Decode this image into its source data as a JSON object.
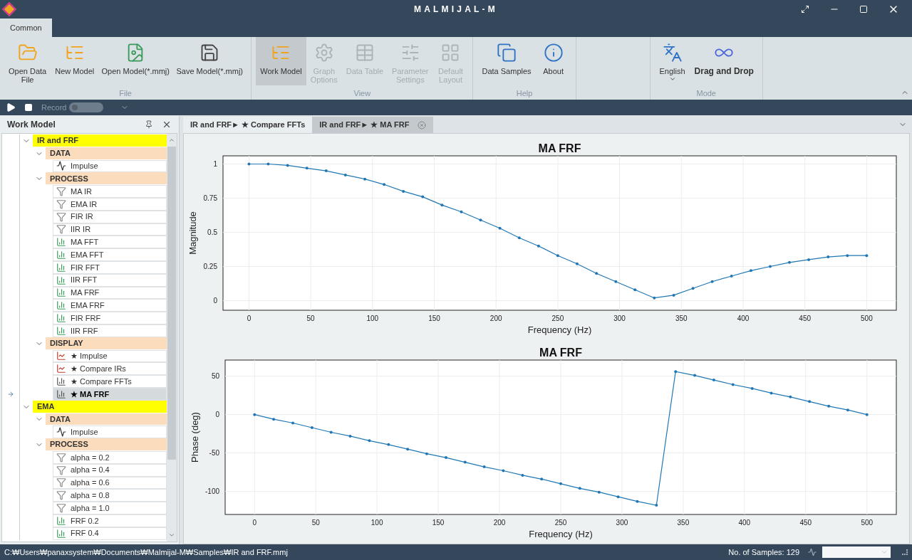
{
  "window": {
    "title": "MALMIJAL-M"
  },
  "ribbon_tabs": [
    {
      "label": "Common",
      "selected": true
    }
  ],
  "ribbon_groups": [
    {
      "label": "File",
      "buttons": [
        {
          "label": "Open Data\nFile",
          "selected": false,
          "disabled": false
        },
        {
          "label": "New Model",
          "selected": false,
          "disabled": false
        },
        {
          "label": "Open Model(*.mmj)",
          "selected": false,
          "disabled": false
        },
        {
          "label": "Save Model(*.mmj)",
          "selected": false,
          "disabled": false
        }
      ]
    },
    {
      "label": "View",
      "buttons": [
        {
          "label": "Work Model",
          "selected": true,
          "disabled": false
        },
        {
          "label": "Graph\nOptions",
          "selected": false,
          "disabled": true
        },
        {
          "label": "Data Table",
          "selected": false,
          "disabled": true
        },
        {
          "label": "Parameter\nSettings",
          "selected": false,
          "disabled": true
        },
        {
          "label": "Default\nLayout",
          "selected": false,
          "disabled": true
        }
      ]
    },
    {
      "label": "Help",
      "buttons": [
        {
          "label": "Data Samples",
          "selected": false,
          "disabled": false
        },
        {
          "label": "About",
          "selected": false,
          "disabled": false
        }
      ]
    },
    {
      "label": "Mode",
      "buttons": [
        {
          "label": "English",
          "selected": false,
          "disabled": false
        },
        {
          "label": "Drag and Drop",
          "selected": false,
          "disabled": false
        }
      ]
    }
  ],
  "toolbar": {
    "record_label": "Record",
    "record_on": false
  },
  "work_model": {
    "title": "Work Model",
    "tree": [
      {
        "label": "IR and FRF",
        "expanded": true,
        "children": [
          {
            "label": "DATA",
            "expanded": true,
            "children": [
              {
                "label": "Impulse",
                "kind": "signal",
                "selected": false
              }
            ]
          },
          {
            "label": "PROCESS",
            "expanded": true,
            "children": [
              {
                "label": "MA IR",
                "kind": "filter",
                "selected": false
              },
              {
                "label": "EMA IR",
                "kind": "filter",
                "selected": false
              },
              {
                "label": "FIR IR",
                "kind": "filter",
                "selected": false
              },
              {
                "label": "IIR IR",
                "kind": "filter",
                "selected": false
              },
              {
                "label": "MA FFT",
                "kind": "spectrum",
                "selected": false
              },
              {
                "label": "EMA FFT",
                "kind": "spectrum",
                "selected": false
              },
              {
                "label": "FIR FFT",
                "kind": "spectrum",
                "selected": false
              },
              {
                "label": "IIR FFT",
                "kind": "spectrum",
                "selected": false
              },
              {
                "label": "MA FRF",
                "kind": "spectrum",
                "selected": false
              },
              {
                "label": "EMA FRF",
                "kind": "spectrum",
                "selected": false
              },
              {
                "label": "FIR FRF",
                "kind": "spectrum",
                "selected": false
              },
              {
                "label": "IIR FRF",
                "kind": "spectrum",
                "selected": false
              }
            ]
          },
          {
            "label": "DISPLAY",
            "expanded": true,
            "children": [
              {
                "label": "★ Impulse",
                "kind": "line-plot",
                "selected": false
              },
              {
                "label": "★ Compare IRs",
                "kind": "line-plot",
                "selected": false
              },
              {
                "label": "★ Compare FFTs",
                "kind": "bar-plot",
                "selected": false
              },
              {
                "label": "★ MA FRF",
                "kind": "bar-plot",
                "selected": true
              }
            ]
          }
        ]
      },
      {
        "label": "EMA",
        "expanded": true,
        "children": [
          {
            "label": "DATA",
            "expanded": true,
            "children": [
              {
                "label": "Impulse",
                "kind": "signal",
                "selected": false
              }
            ]
          },
          {
            "label": "PROCESS",
            "expanded": true,
            "children": [
              {
                "label": "alpha = 0.2",
                "kind": "filter",
                "selected": false
              },
              {
                "label": "alpha = 0.4",
                "kind": "filter",
                "selected": false
              },
              {
                "label": "alpha = 0.6",
                "kind": "filter",
                "selected": false
              },
              {
                "label": "alpha = 0.8",
                "kind": "filter",
                "selected": false
              },
              {
                "label": "alpha = 1.0",
                "kind": "filter",
                "selected": false
              },
              {
                "label": "FRF 0.2",
                "kind": "spectrum",
                "selected": false
              },
              {
                "label": "FRF 0.4",
                "kind": "spectrum",
                "selected": false
              }
            ]
          }
        ]
      }
    ]
  },
  "document_tabs": [
    {
      "label": "IR and FRF► ★ Compare FFTs",
      "selected": false
    },
    {
      "label": "IR and FRF► ★ MA FRF",
      "selected": true
    }
  ],
  "charts": [
    {
      "chart_data": {
        "type": "line",
        "title": "MA FRF",
        "xlabel": "Frequency (Hz)",
        "ylabel": "Magnitude",
        "grid": true,
        "x": [
          0,
          15.6,
          31.3,
          46.9,
          62.5,
          78.1,
          93.8,
          109.4,
          125,
          140.6,
          156.3,
          171.9,
          187.5,
          203.1,
          218.8,
          234.4,
          250,
          265.6,
          281.3,
          296.9,
          312.5,
          328.1,
          343.8,
          359.4,
          375,
          390.6,
          406.3,
          421.9,
          437.5,
          453.1,
          468.8,
          484.4,
          500
        ],
        "series": [
          {
            "color": "#1f77b4",
            "values": [
              1,
              1,
              0.99,
              0.97,
              0.95,
              0.92,
              0.89,
              0.85,
              0.8,
              0.76,
              0.7,
              0.65,
              0.59,
              0.53,
              0.46,
              0.4,
              0.33,
              0.27,
              0.2,
              0.14,
              0.08,
              0.02,
              0.04,
              0.09,
              0.14,
              0.18,
              0.22,
              0.25,
              0.28,
              0.3,
              0.32,
              0.33,
              0.33
            ]
          }
        ],
        "xlim": [
          -21,
          524
        ],
        "ylim": [
          -0.07,
          1.06
        ],
        "xticks": [
          0,
          50,
          100,
          150,
          200,
          250,
          300,
          350,
          400,
          450,
          500
        ],
        "yticks": [
          0,
          0.25,
          0.5,
          0.75,
          1
        ]
      }
    },
    {
      "chart_data": {
        "type": "line",
        "title": "MA FRF",
        "xlabel": "Frequency (Hz)",
        "ylabel": "Phase (deg)",
        "grid": true,
        "x": [
          0,
          15.6,
          31.3,
          46.9,
          62.5,
          78.1,
          93.8,
          109.4,
          125,
          140.6,
          156.3,
          171.9,
          187.5,
          203.1,
          218.8,
          234.4,
          250,
          265.6,
          281.3,
          296.9,
          312.5,
          328.1,
          343.8,
          359.4,
          375,
          390.6,
          406.3,
          421.9,
          437.5,
          453.1,
          468.8,
          484.4,
          500
        ],
        "series": [
          {
            "color": "#1f77b4",
            "values": [
              0,
              -6,
              -11,
              -17,
              -23,
              -28,
              -34,
              -39,
              -45,
              -51,
              -56,
              -62,
              -68,
              -73,
              -79,
              -84,
              -90,
              -96,
              -101,
              -107,
              -113,
              -118,
              56,
              51,
              45,
              39,
              34,
              28,
              23,
              17,
              11,
              6,
              0
            ]
          }
        ],
        "xlim": [
          -24,
          524
        ],
        "ylim": [
          -130,
          71
        ],
        "xticks": [
          0,
          50,
          100,
          150,
          200,
          250,
          300,
          350,
          400,
          450,
          500
        ],
        "yticks": [
          -100,
          -50,
          0,
          50
        ]
      }
    }
  ],
  "status_bar": {
    "path": "C:₩Users₩panaxsystem₩Documents₩Malmijal-M₩Samples₩IR and FRF.mmj",
    "samples": "No. of Samples: 129"
  }
}
